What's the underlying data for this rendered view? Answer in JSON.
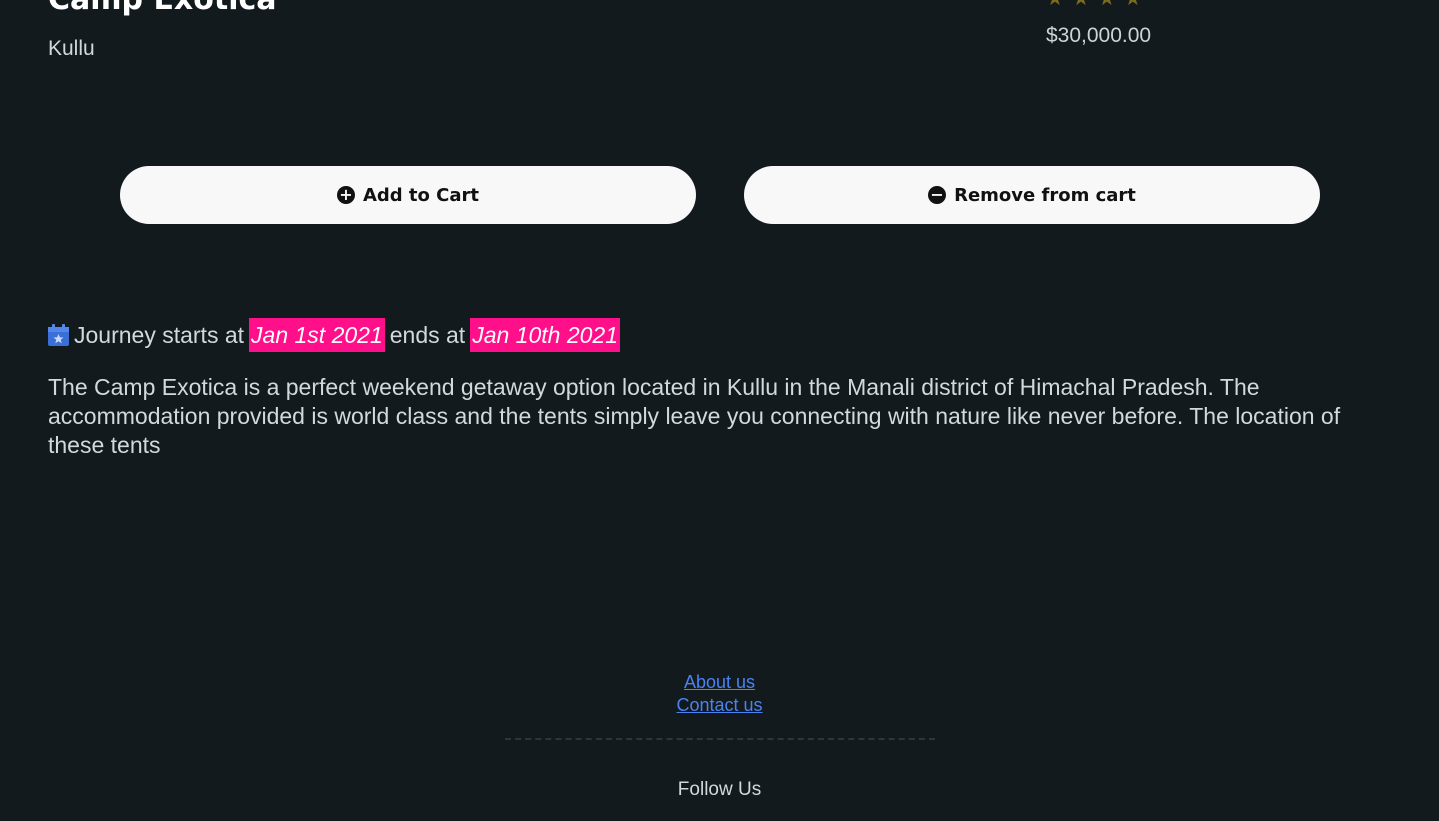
{
  "product": {
    "title": "Camp Exotica",
    "location": "Kullu",
    "price": "$30,000.00",
    "rating": 4,
    "star_glyph": "★"
  },
  "actions": {
    "add_label": "Add to Cart",
    "add_icon": "plus-circle-icon",
    "remove_label": "Remove from cart",
    "remove_icon": "minus-circle-icon"
  },
  "journey": {
    "prefix": "Journey starts at",
    "start_date": "Jan 1st 2021",
    "middle": "ends at",
    "end_date": "Jan 10th 2021",
    "icon": "calendar-star-icon"
  },
  "description": "The Camp Exotica is a perfect weekend getaway option located in Kullu in the Manali district of Himachal Pradesh. The accommodation provided is world class and the tents simply leave you connecting with nature like never before. The location of these tents",
  "footer": {
    "links": [
      "About us",
      "Contact us"
    ],
    "follow_label": "Follow Us"
  },
  "colors": {
    "background": "#121a1e",
    "highlight": "#ff0f8a",
    "link": "#4a82f0",
    "star": "#7d6b1a"
  }
}
